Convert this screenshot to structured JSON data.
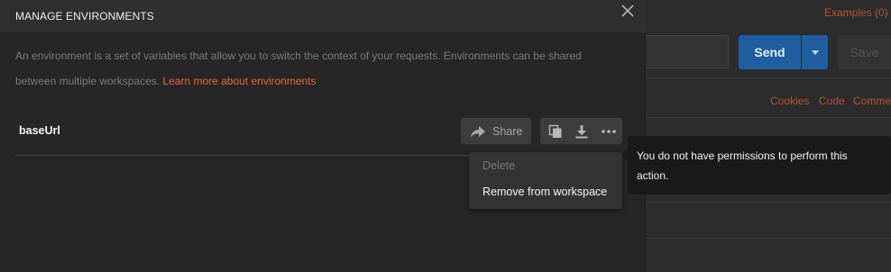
{
  "background_app": {
    "examples_label": "Examples (0)",
    "send_label": "Send",
    "save_label": "Save",
    "cookies_label": "Cookies",
    "code_label": "Code",
    "comments_label": "Comme"
  },
  "modal": {
    "title": "MANAGE ENVIRONMENTS",
    "description": "An environment is a set of variables that allow you to switch the context of your requests. Environments can be shared between multiple workspaces.",
    "learn_more_link": "Learn more about environments",
    "environment": {
      "name": "baseUrl",
      "share_label": "Share"
    },
    "menu": {
      "items": [
        {
          "label": "Delete",
          "enabled": false
        },
        {
          "label": "Remove from workspace",
          "enabled": true
        }
      ]
    },
    "tooltip": "You do not have permissions to perform this action."
  },
  "colors": {
    "accent_link": "#e8673a",
    "send_button": "#1f5ea0",
    "modal_bg": "#262626",
    "tooltip_bg": "#1a1a1a"
  },
  "icons": [
    "close-icon",
    "share-arrow-icon",
    "duplicate-icon",
    "download-icon",
    "more-dots-icon",
    "dropdown-caret-icon"
  ]
}
